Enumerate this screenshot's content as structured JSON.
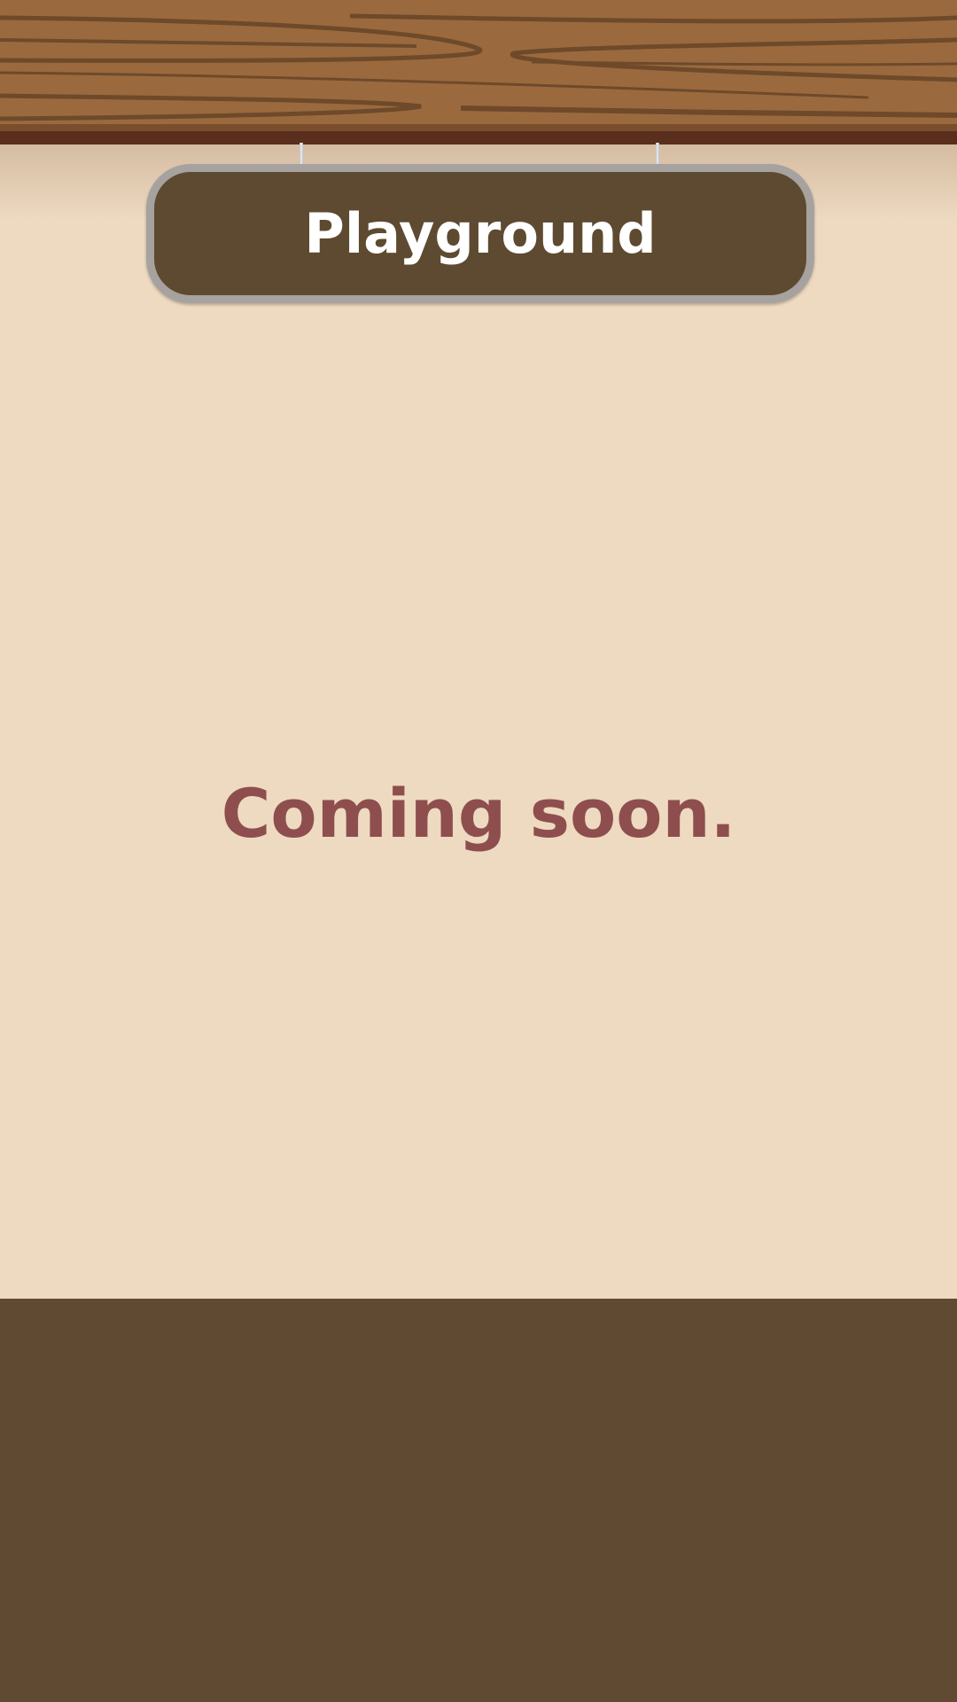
{
  "header": {
    "title": "Playground"
  },
  "main": {
    "message": "Coming soon."
  },
  "colors": {
    "background": "#eddac1",
    "plank": "#9a6a3e",
    "plank_grain": "#6e4a2a",
    "sign_fill": "#5e4a30",
    "sign_border": "#a6a2a0",
    "sign_text": "#ffffff",
    "message_text": "#8f4e4e",
    "footer": "#604a31"
  }
}
